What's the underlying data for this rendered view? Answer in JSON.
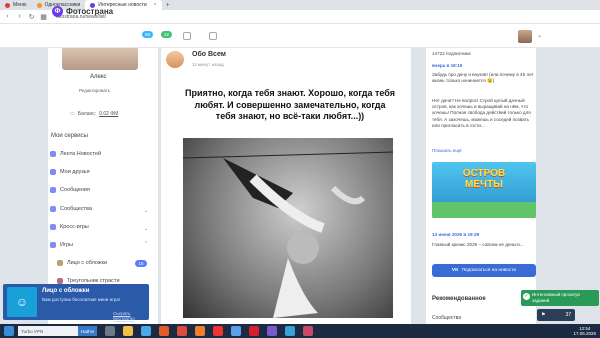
{
  "browser": {
    "tabs": [
      {
        "label": "Меню"
      },
      {
        "label": "Одноклассники"
      },
      {
        "label": "Интересные новости"
      }
    ],
    "url": "fotostrana.ru/news/list/"
  },
  "header": {
    "logo": "Фотострана",
    "badge1": "68",
    "badge2": "22"
  },
  "sidebar": {
    "profile_name": "Алекс",
    "edit_label": "Редактировать",
    "balance_label": "Баланс:",
    "balance_value": "0.02 ФМ",
    "services_title": "Мои сервисы",
    "items": [
      {
        "label": "Лента Новостей"
      },
      {
        "label": "Мои друзья"
      },
      {
        "label": "Сообщения"
      },
      {
        "label": "Сообщества"
      },
      {
        "label": "Кросс-игры"
      },
      {
        "label": "Игры"
      }
    ],
    "games": [
      {
        "label": "Лицо с обложки",
        "badge": "16"
      },
      {
        "label": "Треугольник страсти"
      }
    ]
  },
  "popup": {
    "title": "Лицо с обложки",
    "text": "Вам доступна бесплатная мини игра!",
    "link": "Сыграть бесплатно"
  },
  "post": {
    "author": "Обо Всем",
    "time": "11 минут назад",
    "quote": "Приятно, когда тебя знают. Хорошо, когда тебя любят. И совершенно замечательно, когда тебя знают, но всё-таки любят...))"
  },
  "right": {
    "subscribers": "14722 подписчика",
    "date1": "вчера в 18:16",
    "text1": "Забудь про дачу и внуков! (или почему в 45 лет жизнь только начинается 😉)",
    "text2": "Нет дачи? Не вопрос! Строй целый дачный остров, как хочешь и выращивай на нём, что хочешь! Полная свобода действий только для тебя. А захочешь, можешь и соседей позвать или пригласить в гости...",
    "show_more": "Показать ещё",
    "ad_title": "ОСТРОВ МЕЧТЫ",
    "date2": "13 июня 2026 в 19:29",
    "text3": "Главный кризис 2026 – совсем не деньги...",
    "subscribe": "Подписаться на новости",
    "recommended": "Рекомендованное",
    "communities": "Сообщества"
  },
  "tooltip": {
    "text": "Интенсивный прохогуи заданий"
  },
  "taskbar": {
    "search": "Turbo VPN",
    "find": "Найти",
    "notif_count": "37",
    "time": "12:54",
    "date": "17.06.2026"
  }
}
